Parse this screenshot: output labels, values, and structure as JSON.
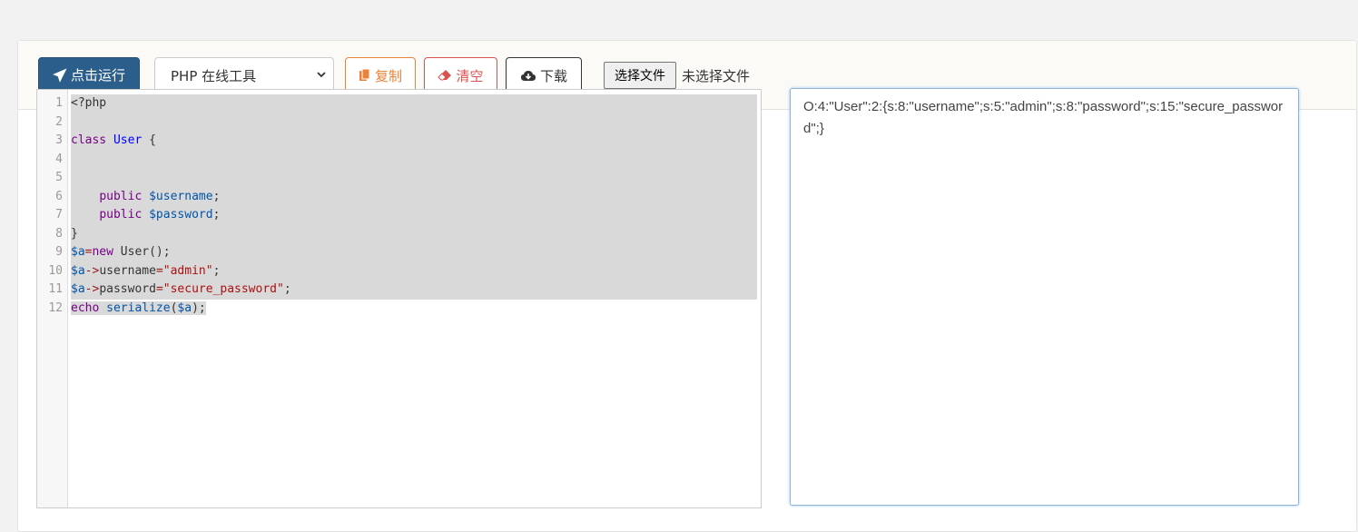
{
  "toolbar": {
    "run_label": "点击运行",
    "language_selected": "PHP 在线工具",
    "copy_label": "复制",
    "clear_label": "清空",
    "download_label": "下载",
    "file_button_label": "选择文件",
    "file_status": "未选择文件"
  },
  "editor": {
    "lines": [
      "1",
      "2",
      "3",
      "4",
      "5",
      "6",
      "7",
      "8",
      "9",
      "10",
      "11",
      "12"
    ]
  },
  "output": {
    "text": "O:4:\"User\":2:{s:8:\"username\";s:5:\"admin\";s:8:\"password\";s:15:\"secure_password\";}"
  },
  "colors": {
    "run_button": "#2c5e8c",
    "copy_button": "#e8833a",
    "clear_button": "#d9534f",
    "selection": "#d9d9d9"
  },
  "icons": [
    "paper-plane-icon",
    "copy-icon",
    "eraser-icon",
    "cloud-download-icon",
    "chevron-down-icon"
  ]
}
